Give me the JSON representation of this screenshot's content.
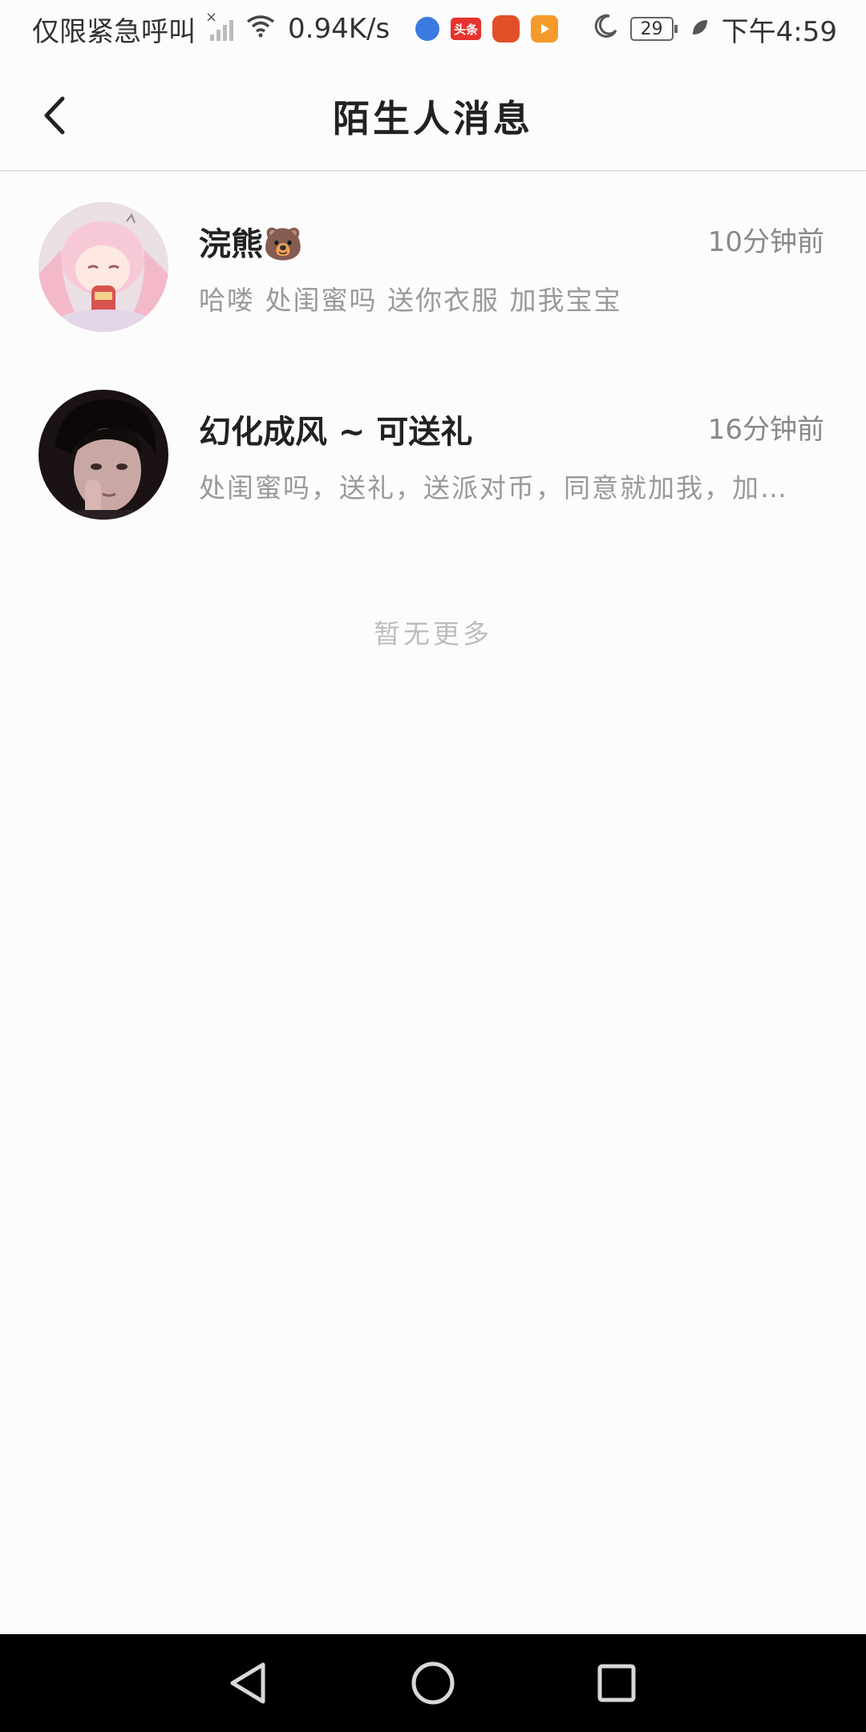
{
  "status_bar": {
    "carrier_text": "仅限紧急呼叫",
    "net_speed": "0.94K/s",
    "toutiao_label": "头条",
    "battery_level": "29",
    "time": "下午4:59"
  },
  "header": {
    "title": "陌生人消息"
  },
  "conversations": [
    {
      "name": "浣熊🐻",
      "time": "10分钟前",
      "preview": "哈喽 处闺蜜吗 送你衣服 加我宝宝"
    },
    {
      "name": "幻化成风 ~ 可送礼",
      "time": "16分钟前",
      "preview": "处闺蜜吗，送礼，送派对币，同意就加我，加…"
    }
  ],
  "list_footer": {
    "text": "暂无更多"
  },
  "colors": {
    "background": "#fdfcfd",
    "nav_bar": "#000000",
    "secondary_text": "#999999",
    "divider": "#e2e2e4"
  }
}
